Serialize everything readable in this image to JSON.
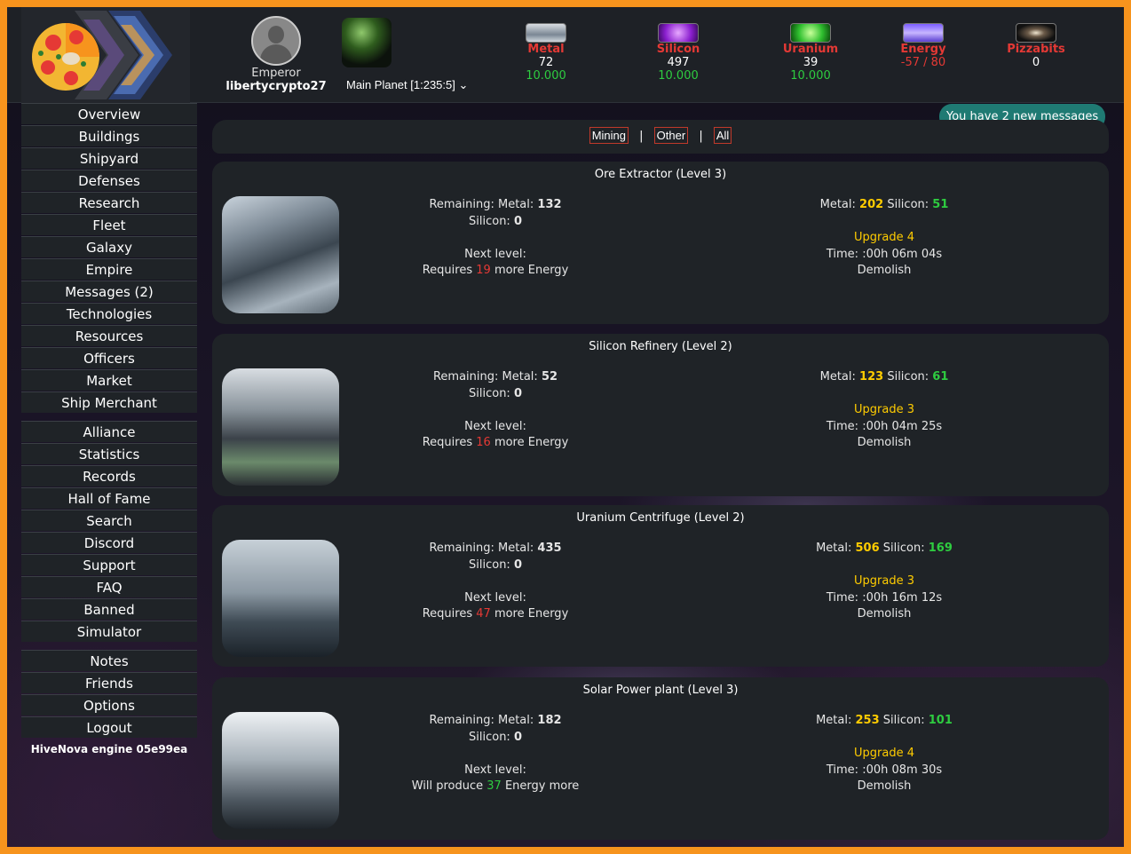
{
  "header": {
    "rank": "Emperor",
    "username": "libertycrypto27",
    "planet_select": "Main Planet [1:235:5] ⌄",
    "resources": [
      {
        "name": "Metal",
        "current": "72",
        "max": "10.000",
        "name_color": "#e53935",
        "current_color": "#ffffff",
        "max_color": "#2ecc40",
        "icon": "metal-ore-icon"
      },
      {
        "name": "Silicon",
        "current": "497",
        "max": "10.000",
        "name_color": "#e53935",
        "current_color": "#ffffff",
        "max_color": "#2ecc40",
        "icon": "silicon-crystal-icon"
      },
      {
        "name": "Uranium",
        "current": "39",
        "max": "10.000",
        "name_color": "#e53935",
        "current_color": "#ffffff",
        "max_color": "#2ecc40",
        "icon": "uranium-swirl-icon"
      },
      {
        "name": "Energy",
        "current": "-57 / 80",
        "max": "",
        "name_color": "#e53935",
        "current_color": "#e53935",
        "max_color": "#2ecc40",
        "icon": "energy-lightning-icon"
      },
      {
        "name": "Pizzabits",
        "current": "0",
        "max": "",
        "name_color": "#e53935",
        "current_color": "#ffffff",
        "max_color": "#2ecc40",
        "icon": "galaxy-icon"
      }
    ]
  },
  "nav": {
    "group1": [
      "Overview",
      "Buildings",
      "Shipyard",
      "Defenses",
      "Research",
      "Fleet",
      "Galaxy",
      "Empire",
      "Messages (2)",
      "Technologies",
      "Resources",
      "Officers",
      "Market",
      "Ship Merchant"
    ],
    "group2": [
      "Alliance",
      "Statistics",
      "Records",
      "Hall of Fame",
      "Search",
      "Discord",
      "Support",
      "FAQ",
      "Banned",
      "Simulator"
    ],
    "group3": [
      "Notes",
      "Friends",
      "Options",
      "Logout"
    ],
    "engine": "HiveNova engine 05e99ea"
  },
  "messages_badge": "You have 2 new messages",
  "filters": {
    "mining": "Mining",
    "other": "Other",
    "all": "All",
    "sep": "|"
  },
  "labels": {
    "remaining": "Remaining:",
    "metal": "Metal:",
    "silicon": "Silicon:",
    "next_level": "Next level:",
    "requires": "Requires",
    "more_energy": "more Energy",
    "will_produce": "Will produce",
    "energy_more": "Energy more",
    "time": "Time:",
    "demolish": "Demolish"
  },
  "buildings": [
    {
      "title": "Ore Extractor (Level 3)",
      "rem_metal": "132",
      "rem_silicon": "0",
      "energy_mode": "requires",
      "energy": "19",
      "cost_metal": "202",
      "cost_silicon": "51",
      "upgrade": "Upgrade 4",
      "time": ":00h 06m 04s"
    },
    {
      "title": "Silicon Refinery (Level 2)",
      "rem_metal": "52",
      "rem_silicon": "0",
      "energy_mode": "requires",
      "energy": "16",
      "cost_metal": "123",
      "cost_silicon": "61",
      "upgrade": "Upgrade 3",
      "time": ":00h 04m 25s"
    },
    {
      "title": "Uranium Centrifuge (Level 2)",
      "rem_metal": "435",
      "rem_silicon": "0",
      "energy_mode": "requires",
      "energy": "47",
      "cost_metal": "506",
      "cost_silicon": "169",
      "upgrade": "Upgrade 3",
      "time": ":00h 16m 12s"
    },
    {
      "title": "Solar Power plant (Level 3)",
      "rem_metal": "182",
      "rem_silicon": "0",
      "energy_mode": "produce",
      "energy": "37",
      "cost_metal": "253",
      "cost_silicon": "101",
      "upgrade": "Upgrade 4",
      "time": ":00h 08m 30s"
    }
  ]
}
